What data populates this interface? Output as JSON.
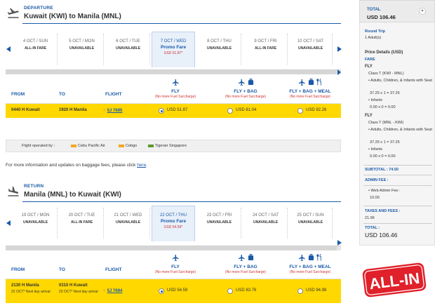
{
  "departure": {
    "label": "DEPARTURE",
    "route": "Kuwait (KWI) to Manila (MNL)",
    "dates": [
      {
        "date": "4 OCT / SUN",
        "status": "ALL-IN FARE"
      },
      {
        "date": "5 OCT / MON",
        "status": "UNAVAILABLE"
      },
      {
        "date": "6 OCT / TUE",
        "status": "UNAVAILABLE"
      },
      {
        "date": "7 OCT / WED",
        "promo": "Promo Fare",
        "price": "USD 51.87*",
        "selected": true
      },
      {
        "date": "8 OCT / THU",
        "status": "UNAVAILABLE"
      },
      {
        "date": "9 OCT / FRI",
        "status": "ALL-IN FARE"
      },
      {
        "date": "10 OCT / SAT",
        "status": "UNAVAILABLE"
      }
    ],
    "row": {
      "from_time": "0440 H",
      "from_city": "Kuwait",
      "to_time": "1920 H",
      "to_city": "Manila",
      "flight": "5J 7695",
      "prices": [
        "USD 51.87",
        "USD 81.04",
        "USD 92.26"
      ]
    }
  },
  "table_headers": {
    "from": "FROM",
    "to": "TO",
    "flight": "FLIGHT"
  },
  "fare_types": [
    {
      "name": "FLY",
      "note": "(No more Fuel Surcharge)"
    },
    {
      "name": "FLY + BAG",
      "note": "(No more Fuel Surcharge)"
    },
    {
      "name": "FLY + BAG + MEAL",
      "note": "(No more Fuel Surcharge)"
    }
  ],
  "operated_by": {
    "label": "Flight operated by :",
    "airlines": [
      {
        "name": "Cebu Pacific Air",
        "color": "#f5a623"
      },
      {
        "name": "Cebgo",
        "color": "#f5a623"
      },
      {
        "name": "Tigerair Singapore",
        "color": "#5a9a2a"
      }
    ]
  },
  "info": {
    "text": "For more information and updates on baggage fees, please click",
    "link": "here",
    "tail": "."
  },
  "return": {
    "label": "RETURN",
    "route": "Manila (MNL) to Kuwait (KWI)",
    "dates": [
      {
        "date": "19 OCT / MON",
        "status": "UNAVAILABLE"
      },
      {
        "date": "20 OCT / TUE",
        "status": "ALL-IN FARE"
      },
      {
        "date": "21 OCT / WED",
        "status": "UNAVAILABLE"
      },
      {
        "date": "22 OCT / THU",
        "promo": "Promo Fare",
        "price": "USD 54.59*",
        "selected": true
      },
      {
        "date": "23 OCT / FRI",
        "status": "UNAVAILABLE"
      },
      {
        "date": "24 OCT / SAT",
        "status": "UNAVAILABLE"
      },
      {
        "date": "25 OCT / SUN",
        "status": "UNAVAILABLE"
      }
    ],
    "row": {
      "from_time": "2130 H",
      "from_city": "Manila",
      "from_note": "22 OCT*   Next day arrival",
      "to_time": "0310 H",
      "to_city": "Kuwait",
      "to_note": "23 OCT*   Next day arrival",
      "flight": "5J 7694",
      "prices": [
        "USD 54.59",
        "USD 83.76",
        "USD 94.98"
      ]
    }
  },
  "summary": {
    "title": "TOTAL",
    "total_top": "USD 106.46",
    "trip": "Round Trip",
    "adults": "1 Adult(s)",
    "price_details": "Price Details (USD)",
    "fare_label": "FARE",
    "fly1": "FLY",
    "class1": "Class T (KWI - MNL)",
    "people1": "• Adults, Children, & Infants with Seat",
    "calc1": "37.25 x 1 = 37.25",
    "inf1": "• Infants",
    "inf_calc1": "0.00 x 0 = 0.00",
    "fly2": "FLY",
    "class2": "Class T (MNL - KWI)",
    "people2": "• Adults, Children, & Infants with Seat",
    "calc2": "37.25 x 1 = 37.25",
    "inf2": "• Infants",
    "inf_calc2": "0.00 x 0 = 0.00",
    "subtotal": "SUBTOTAL : 74.50",
    "admin_label": "ADMIN FEE :",
    "web_admin": "• Web Admin Fee :",
    "web_admin_val": "10.00",
    "taxes_label": "TAXES AND FEES :",
    "taxes_val": "21.96",
    "total_label": "TOTAL :",
    "total_val": "USD  106.46"
  },
  "badge_text": "ALL-IN",
  "colors": {
    "brand_blue": "#1a5aa8",
    "highlight_yellow": "#ffd800",
    "badge_red": "#e0202a"
  }
}
